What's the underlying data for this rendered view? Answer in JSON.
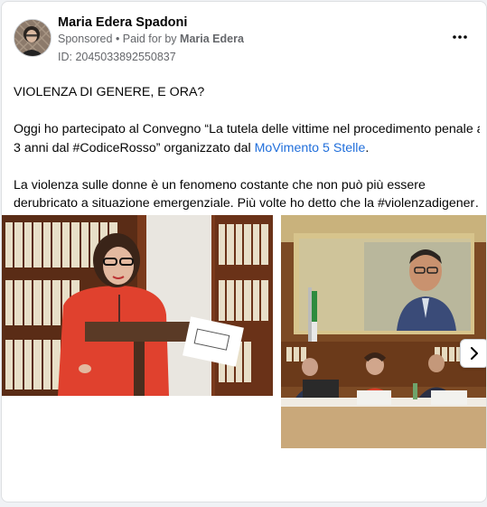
{
  "post": {
    "author": "Maria Edera Spadoni",
    "sponsored_label": "Sponsored",
    "paid_prefix": " • Paid for by ",
    "paid_by": "Maria Edera",
    "ad_id": "ID: 2045033892550837",
    "text": {
      "headline": "VIOLENZA DI GENERE, E ORA?",
      "p2_line1": "Oggi ho partecipato al Convegno “La tutela delle vittime nel procedimento penale a",
      "p2_line2_pre": "3 anni dal #CodiceRosso” organizzato dal ",
      "p2_link": "MoVimento 5 Stelle",
      "p2_line2_post": ".",
      "p3_line1": "La violenza sulle donne è un fenomeno costante che non può più essere",
      "p3_line2": "derubricato a situazione emergenziale. Più volte ho detto che la #violenzadigener…"
    }
  },
  "icons": {
    "more": "more-horizontal-icon",
    "next": "chevron-right-icon"
  },
  "colors": {
    "link": "#216fdb",
    "meta_text": "#65676b",
    "background": "#f0f2f5"
  }
}
